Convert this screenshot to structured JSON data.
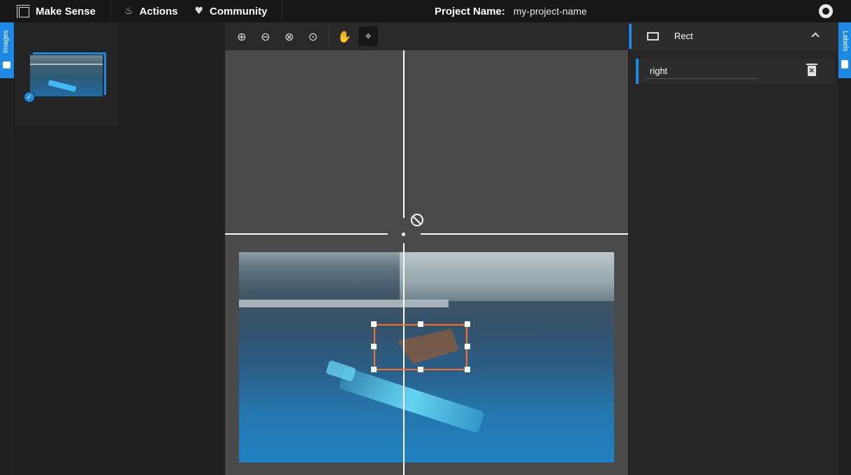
{
  "app": {
    "title": "Make Sense",
    "menu": [
      {
        "label": "Actions",
        "icon": "flame-icon"
      },
      {
        "label": "Community",
        "icon": "heart-icon"
      }
    ],
    "project_label": "Project Name:",
    "project_value": "my-project-name",
    "github_icon": "github-icon"
  },
  "side_tabs": {
    "left": "Images",
    "right": "Labels"
  },
  "toolbar": {
    "tools": [
      "zoom-in-icon",
      "zoom-out-icon",
      "zoom-fit-icon",
      "zoom-actual-icon",
      "pan-hand-icon",
      "crosshair-target-icon"
    ],
    "active_tool": "crosshair-target-icon"
  },
  "right_panel": {
    "section_title": "Rect",
    "labels": [
      {
        "value": "right"
      }
    ]
  },
  "colors": {
    "accent": "#1e88e5",
    "bbox": "#ff6f28"
  }
}
